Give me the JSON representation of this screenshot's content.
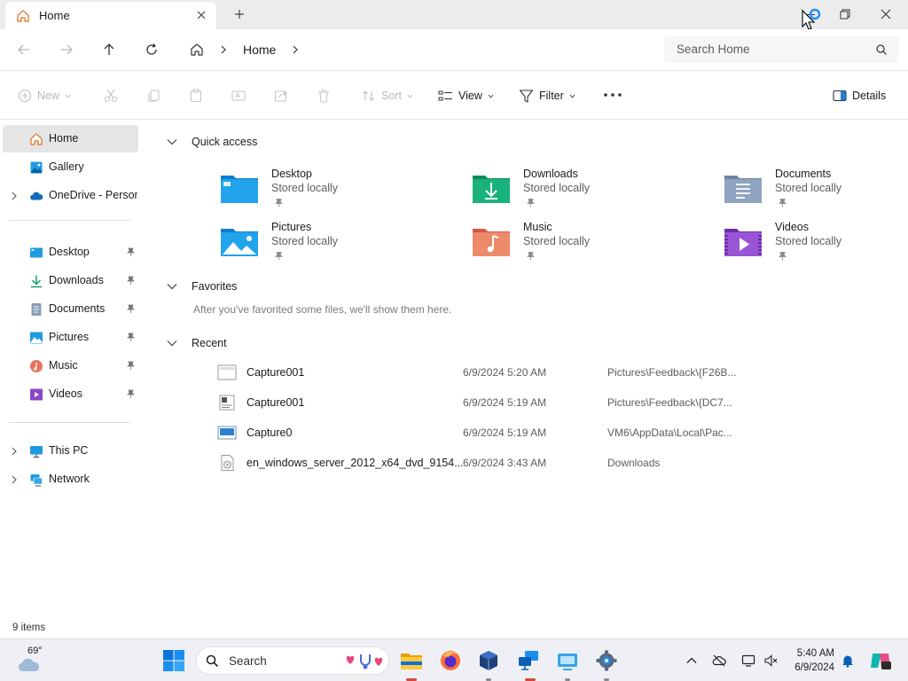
{
  "tab": {
    "title": "Home"
  },
  "breadcrumb": {
    "current": "Home"
  },
  "search": {
    "placeholder": "Search Home"
  },
  "commands": {
    "new": "New",
    "sort": "Sort",
    "view": "View",
    "filter": "Filter",
    "details": "Details"
  },
  "sidebar": {
    "items": [
      {
        "label": "Home"
      },
      {
        "label": "Gallery"
      },
      {
        "label": "OneDrive - Persona"
      },
      {
        "label": "Desktop"
      },
      {
        "label": "Downloads"
      },
      {
        "label": "Documents"
      },
      {
        "label": "Pictures"
      },
      {
        "label": "Music"
      },
      {
        "label": "Videos"
      },
      {
        "label": "This PC"
      },
      {
        "label": "Network"
      }
    ]
  },
  "sections": {
    "quick_access": "Quick access",
    "favorites": "Favorites",
    "favorites_note": "After you've favorited some files, we'll show them here.",
    "recent": "Recent"
  },
  "quick_access": [
    {
      "name": "Desktop",
      "sub": "Stored locally"
    },
    {
      "name": "Downloads",
      "sub": "Stored locally"
    },
    {
      "name": "Documents",
      "sub": "Stored locally"
    },
    {
      "name": "Pictures",
      "sub": "Stored locally"
    },
    {
      "name": "Music",
      "sub": "Stored locally"
    },
    {
      "name": "Videos",
      "sub": "Stored locally"
    }
  ],
  "recent": [
    {
      "name": "Capture001",
      "date": "6/9/2024 5:20 AM",
      "location": "Pictures\\Feedback\\{F26B..."
    },
    {
      "name": "Capture001",
      "date": "6/9/2024 5:19 AM",
      "location": "Pictures\\Feedback\\{DC7..."
    },
    {
      "name": "Capture0",
      "date": "6/9/2024 5:19 AM",
      "location": "VM6\\AppData\\Local\\Pac..."
    },
    {
      "name": "en_windows_server_2012_x64_dvd_9154...",
      "date": "6/9/2024 3:43 AM",
      "location": "Downloads"
    }
  ],
  "status": {
    "items": "9 items"
  },
  "taskbar": {
    "temperature": "69°",
    "search_label": "Search",
    "time": "5:40 AM",
    "date": "6/9/2024"
  },
  "colors": {
    "accent": "#0067c0",
    "selected_bg": "#e5e5e5",
    "folder_blue": "#1f9be0"
  }
}
